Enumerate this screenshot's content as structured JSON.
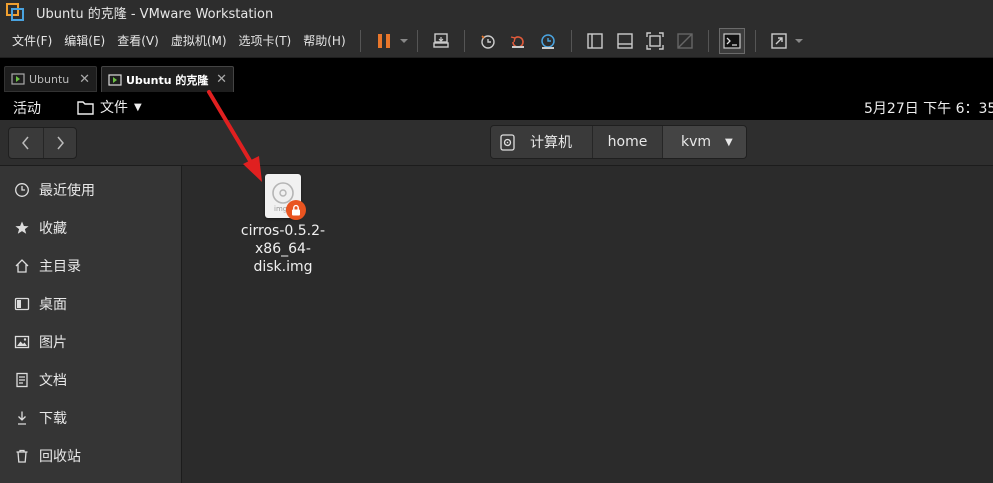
{
  "window": {
    "title": "Ubuntu 的克隆 - VMware Workstation"
  },
  "menu": {
    "items": [
      "文件(F)",
      "编辑(E)",
      "查看(V)",
      "虚拟机(M)",
      "选项卡(T)",
      "帮助(H)"
    ]
  },
  "tabs": [
    {
      "label": "Ubuntu",
      "active": false
    },
    {
      "label": "Ubuntu 的克隆",
      "active": true
    }
  ],
  "ubuntu_topbar": {
    "activities": "活动",
    "app_menu": "文件",
    "clock": "5月27日 下午 6：35"
  },
  "path": {
    "crumbs": [
      "计算机",
      "home",
      "kvm"
    ]
  },
  "sidebar": {
    "items": [
      {
        "label": "最近使用",
        "icon": "clock-icon"
      },
      {
        "label": "收藏",
        "icon": "star-icon"
      },
      {
        "label": "主目录",
        "icon": "home-icon"
      },
      {
        "label": "桌面",
        "icon": "desktop-icon"
      },
      {
        "label": "图片",
        "icon": "pictures-icon"
      },
      {
        "label": "文档",
        "icon": "documents-icon"
      },
      {
        "label": "下载",
        "icon": "download-icon"
      },
      {
        "label": "回收站",
        "icon": "trash-icon"
      }
    ]
  },
  "files": [
    {
      "name_lines": [
        "cirros-0.5.2-",
        "x86_64-",
        "disk.img"
      ],
      "icon_badge": "img",
      "locked": true
    }
  ],
  "colors": {
    "accent_orange": "#e95420",
    "pause_orange": "#e8762b",
    "annotation_red": "#e02020"
  }
}
